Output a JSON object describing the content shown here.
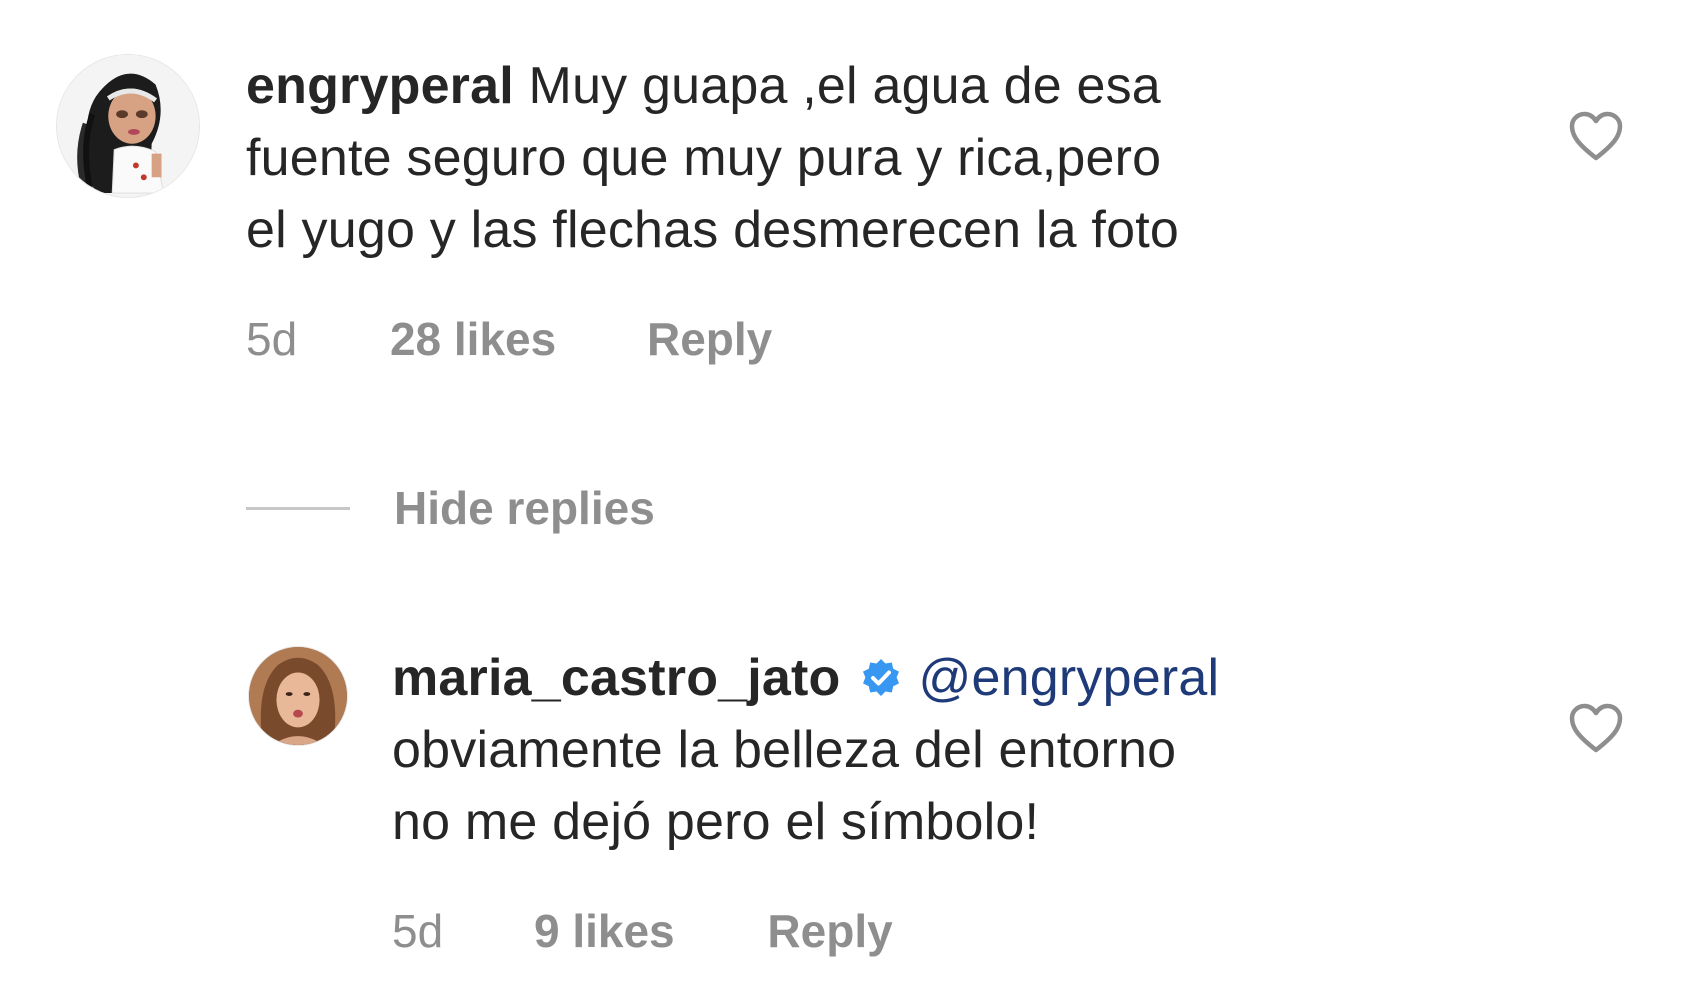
{
  "comment": {
    "username": "engryperal",
    "text_line1": "Muy guapa ,el agua de esa",
    "text_line2": "fuente seguro que muy pura y rica,pero",
    "text_line3": "el yugo y las flechas desmerecen la foto",
    "time": "5d",
    "likes": "28 likes",
    "reply_label": "Reply"
  },
  "hide_replies_label": "Hide replies",
  "reply": {
    "username": "maria_castro_jato",
    "verified": true,
    "mention": "@engryperal",
    "text_line1": "obviamente la belleza del entorno",
    "text_line2": "no me dejó pero el símbolo!",
    "time": "5d",
    "likes": "9 likes",
    "reply_label": "Reply"
  },
  "icons": {
    "like": "heart-outline-icon",
    "verified": "verified-badge-icon"
  },
  "colors": {
    "text": "#262626",
    "secondary": "#8e8e8e",
    "mention": "#1f3a78",
    "verified": "#3897f0"
  }
}
